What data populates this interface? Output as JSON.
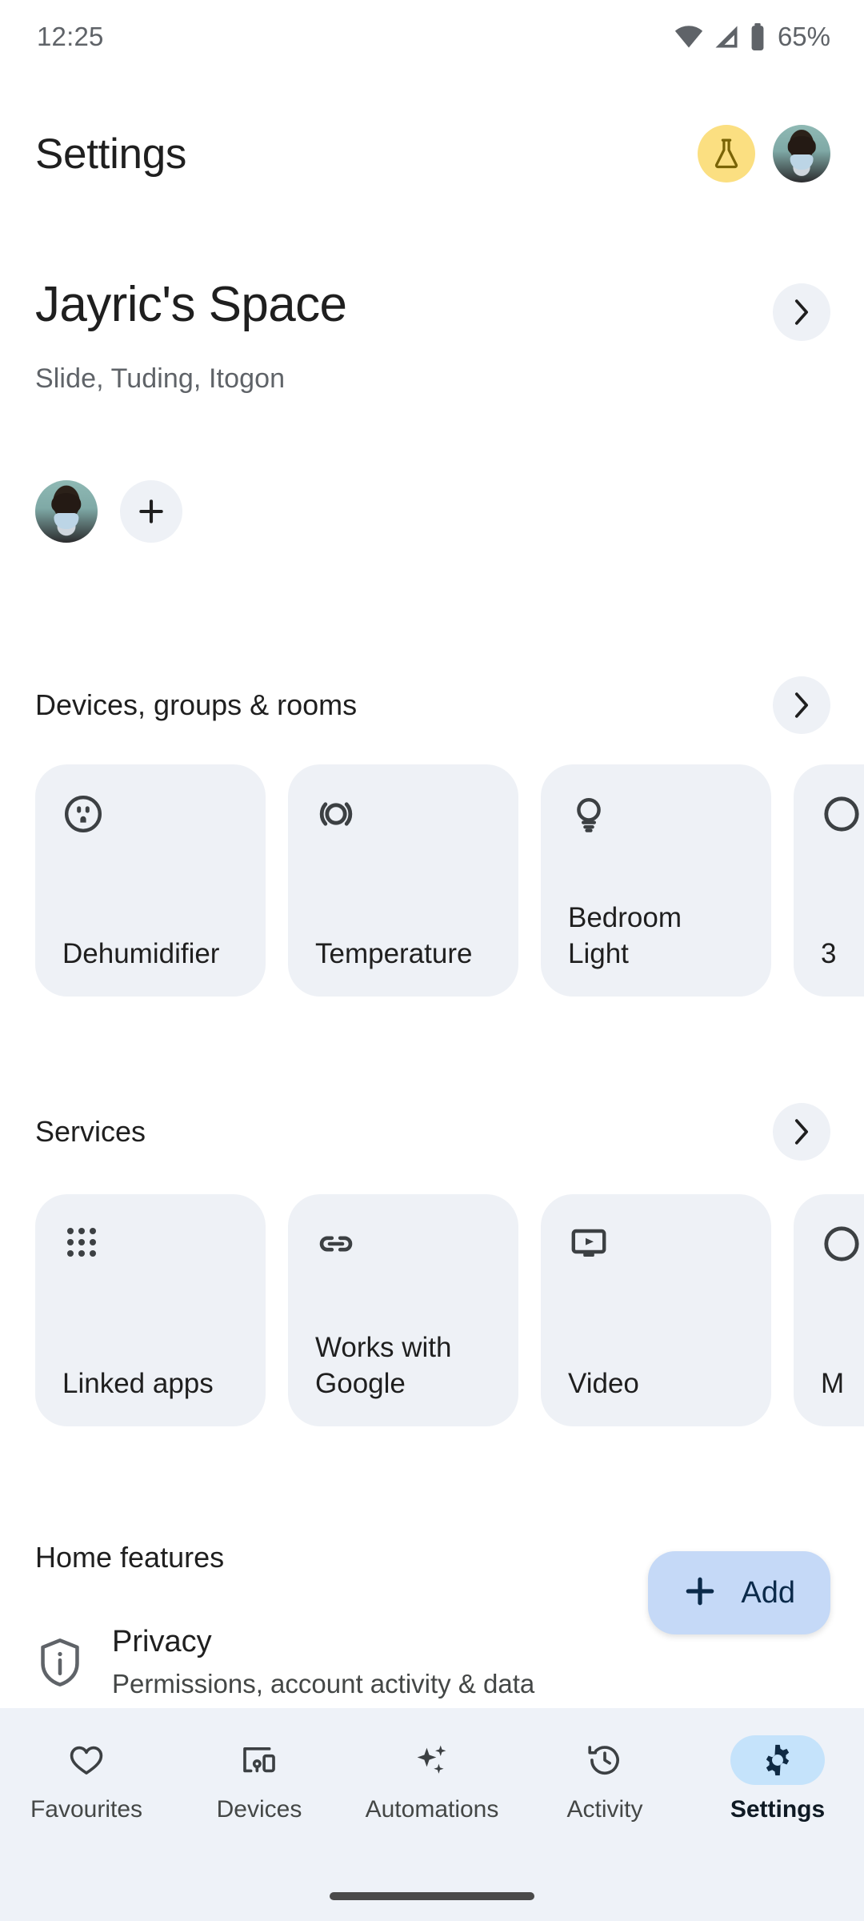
{
  "status_bar": {
    "time": "12:25",
    "battery_percent": "65%",
    "icons": [
      "wifi-icon",
      "cellular-signal-icon",
      "battery-icon"
    ]
  },
  "app_bar": {
    "title": "Settings",
    "flask_badge_icon": "flask-icon",
    "account_avatar": "account-avatar"
  },
  "home": {
    "name": "Jayric's Space",
    "address": "Slide, Tuding, Itogon",
    "open_icon": "chevron-right-icon",
    "members": [
      {
        "name": "member-avatar"
      }
    ],
    "add_member_label": "+"
  },
  "devices_section": {
    "title": "Devices, groups & rooms",
    "open_icon": "chevron-right-icon",
    "cards": [
      {
        "label": "Dehumidifier",
        "icon": "power-outlet-icon"
      },
      {
        "label": "Temperature",
        "icon": "sensor-icon"
      },
      {
        "label": "Bedroom Light",
        "icon": "light-bulb-icon"
      },
      {
        "label": "3",
        "icon": "circle-icon"
      }
    ]
  },
  "services_section": {
    "title": "Services",
    "open_icon": "chevron-right-icon",
    "cards": [
      {
        "label": "Linked apps",
        "icon": "apps-grid-icon"
      },
      {
        "label": "Works with Google",
        "icon": "link-icon"
      },
      {
        "label": "Video",
        "icon": "video-tv-icon"
      },
      {
        "label": "M",
        "icon": "partial-icon"
      }
    ]
  },
  "home_features": {
    "title": "Home features",
    "items": [
      {
        "name": "Privacy",
        "description": "Permissions, account activity & data",
        "icon": "shield-info-icon"
      }
    ]
  },
  "fab": {
    "label": "Add",
    "icon": "plus-icon",
    "background": "#c5d9f7",
    "foreground": "#0b2a4a"
  },
  "bottom_nav": {
    "active": "Settings",
    "items": [
      {
        "label": "Favourites",
        "icon": "heart-icon"
      },
      {
        "label": "Devices",
        "icon": "devices-icon"
      },
      {
        "label": "Automations",
        "icon": "sparkle-icon"
      },
      {
        "label": "Activity",
        "icon": "history-clock-icon"
      },
      {
        "label": "Settings",
        "icon": "gear-icon"
      }
    ]
  },
  "colors": {
    "card_bg": "#eef1f6",
    "nav_bg": "#eef2f8",
    "accent_badge": "#fbdf81",
    "active_pill": "#c5e3fb"
  }
}
